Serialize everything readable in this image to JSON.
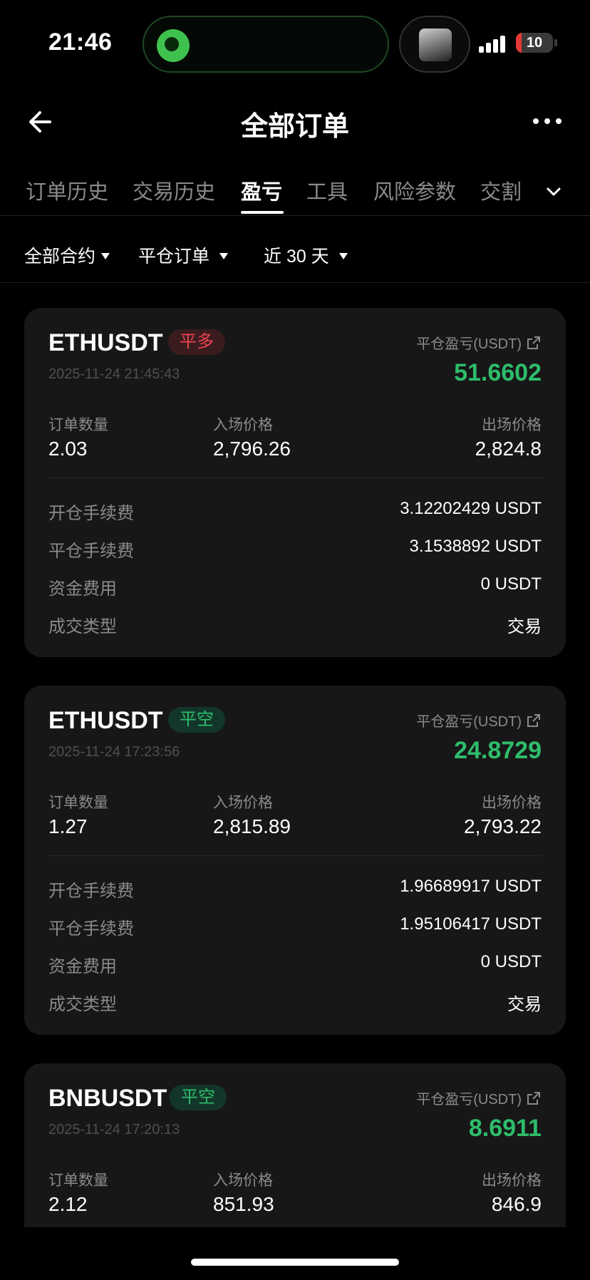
{
  "status_bar": {
    "time": "21:46",
    "battery": "10"
  },
  "header": {
    "title": "全部订单"
  },
  "tabs": [
    "订单历史",
    "交易历史",
    "盈亏",
    "工具",
    "风险参数",
    "交割"
  ],
  "active_tab": "盈亏",
  "filters": {
    "contract": "全部合约",
    "order_type": "平仓订单",
    "period": "近 30 天"
  },
  "labels": {
    "pnl": "平仓盈亏(USDT)",
    "qty": "订单数量",
    "entry": "入场价格",
    "exit": "出场价格",
    "open_fee": "开仓手续费",
    "close_fee": "平仓手续费",
    "funding": "资金费用",
    "trade_type": "成交类型"
  },
  "orders": [
    {
      "symbol": "ETHUSDT",
      "side": "平多",
      "time": "2025-11-24 21:45:43",
      "pnl": "51.6602",
      "qty": "2.03",
      "entry": "2,796.26",
      "exit": "2,824.8",
      "open_fee": "3.12202429 USDT",
      "close_fee": "3.1538892 USDT",
      "funding": "0 USDT",
      "trade_type": "交易"
    },
    {
      "symbol": "ETHUSDT",
      "side": "平空",
      "time": "2025-11-24 17:23:56",
      "pnl": "24.8729",
      "qty": "1.27",
      "entry": "2,815.89",
      "exit": "2,793.22",
      "open_fee": "1.96689917 USDT",
      "close_fee": "1.95106417 USDT",
      "funding": "0 USDT",
      "trade_type": "交易"
    },
    {
      "symbol": "BNBUSDT",
      "side": "平空",
      "time": "2025-11-24 17:20:13",
      "pnl": "8.6911",
      "qty": "2.12",
      "entry": "851.93",
      "exit": "846.9"
    }
  ],
  "colors": {
    "profit": "#2ebd6b",
    "long_badge": "#f0454f",
    "short_badge": "#2ebd6b",
    "card_bg": "#171717"
  }
}
